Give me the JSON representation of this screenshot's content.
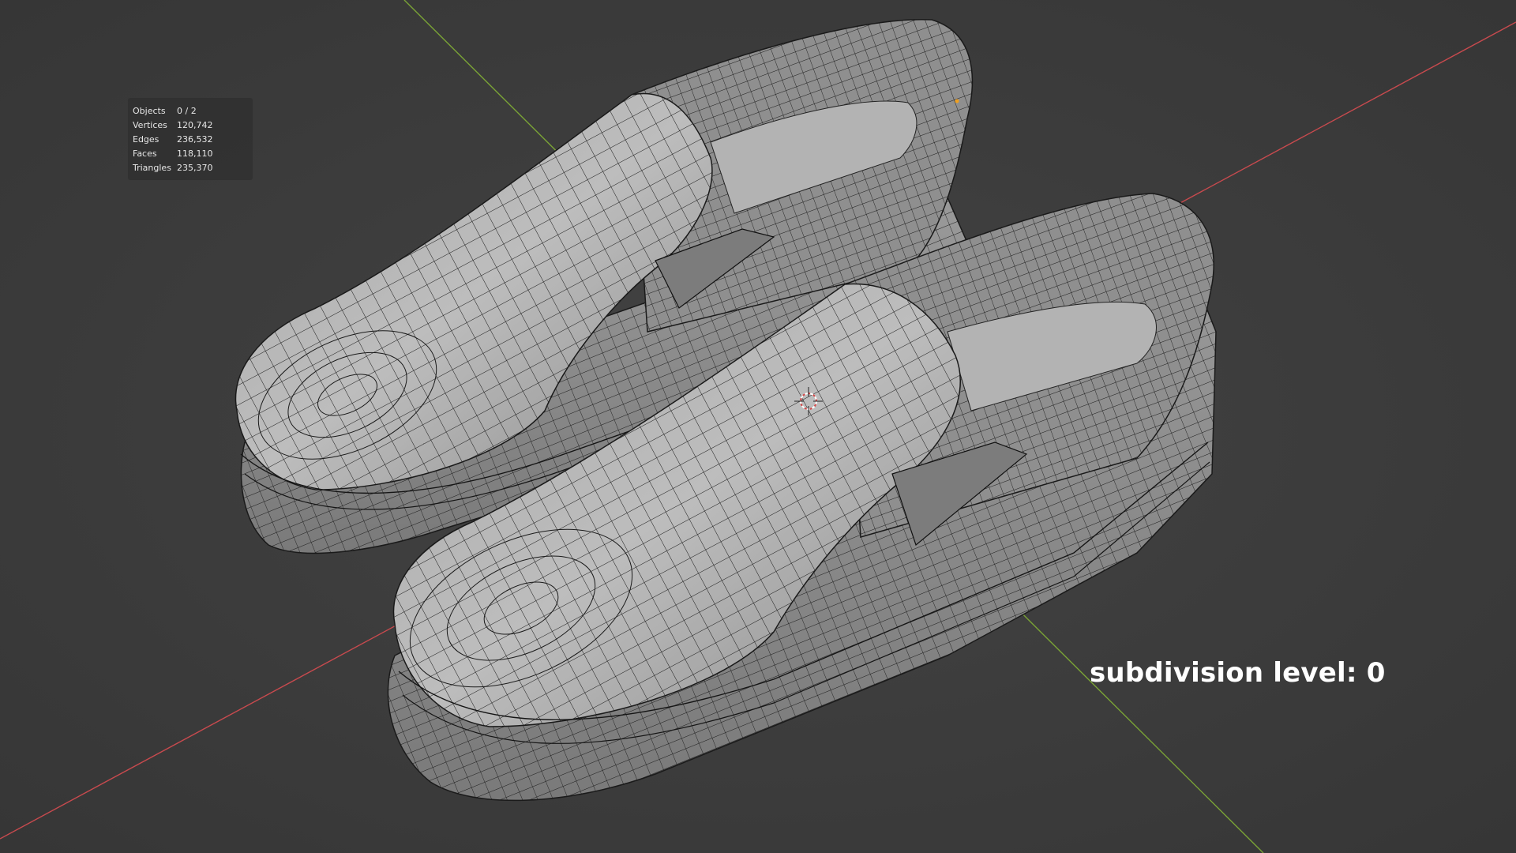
{
  "stats": {
    "rows": [
      {
        "label": "Objects",
        "value": "0 / 2"
      },
      {
        "label": "Vertices",
        "value": "120,742"
      },
      {
        "label": "Edges",
        "value": "236,532"
      },
      {
        "label": "Faces",
        "value": "118,110"
      },
      {
        "label": "Triangles",
        "value": "235,370"
      }
    ]
  },
  "overlay": {
    "caption": "subdivision level: 0"
  },
  "colors": {
    "background": "#3d3d3d",
    "x_axis": "#c84a4e",
    "y_axis": "#7aa336",
    "mesh_fill": "#9b9b9b",
    "wire": "#1a1a1a"
  },
  "icons": [
    "3d-cursor-icon",
    "origin-point-icon"
  ]
}
